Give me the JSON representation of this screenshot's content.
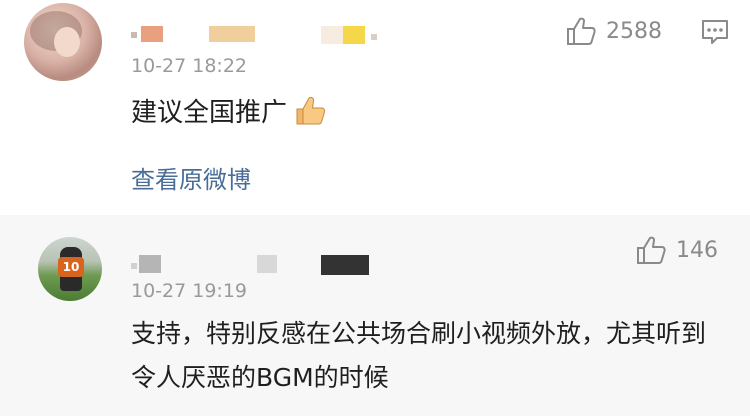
{
  "comments": [
    {
      "time": "10-27 18:22",
      "likes": "2588",
      "text": "建议全国推广",
      "emoji": "thumbs-up-emoji",
      "link": "查看原微博",
      "redacted_name_colors": [
        "#e9a07f",
        "#f1cf9c",
        "#f4d84a"
      ]
    },
    {
      "time": "10-27 19:19",
      "likes": "146",
      "text": "支持，特别反感在公共场合刷小视频外放，尤其听到令人厌恶的BGM的时候",
      "redacted_name_colors": [
        "#b5b5b5",
        "#d8d8d8",
        "#333333"
      ]
    }
  ],
  "colors": {
    "link": "#4a6d98",
    "muted": "#9a9a9a",
    "second_bg": "#f7f7f7"
  }
}
